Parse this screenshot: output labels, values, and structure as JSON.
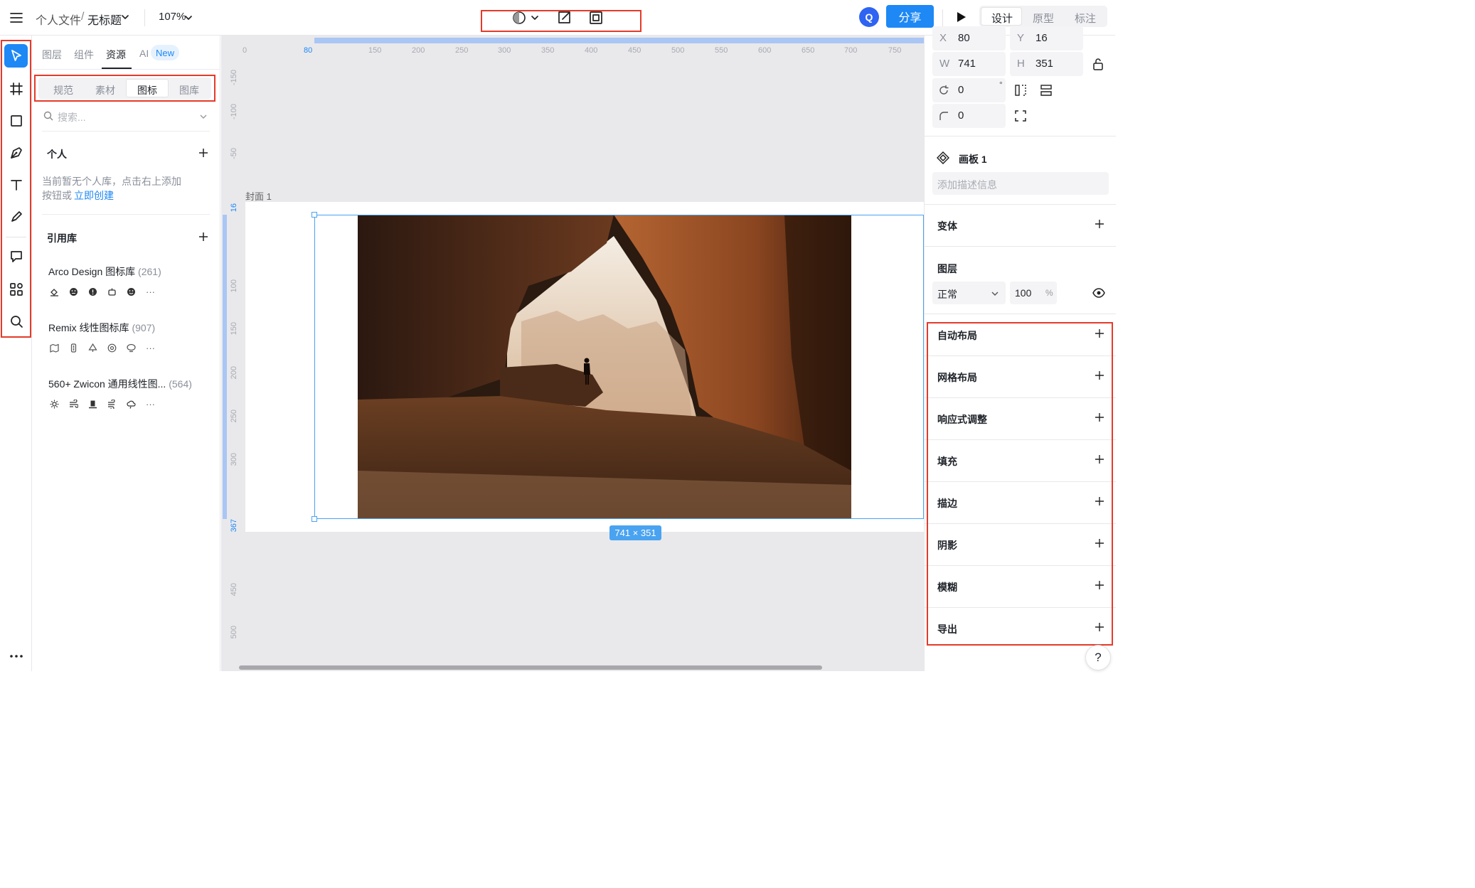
{
  "header": {
    "breadcrumb_parent": "个人文件",
    "breadcrumb_sep": "/",
    "file_name": "无标题",
    "zoom": "107%",
    "avatar_letter": "Q",
    "share_label": "分享",
    "mode_tabs": [
      "设计",
      "原型",
      "标注"
    ]
  },
  "left_panel": {
    "tabs": [
      "图层",
      "组件",
      "资源",
      "AI"
    ],
    "ai_badge": "New",
    "subtabs": [
      "规范",
      "素材",
      "图标",
      "图库"
    ],
    "search_placeholder": "搜索...",
    "personal_title": "个人",
    "personal_empty_line1": "当前暂无个人库，点击右上添加",
    "personal_empty_line2": "按钮或",
    "personal_create_link": "立即创建",
    "ref_title": "引用库",
    "libraries": [
      {
        "name": "Arco Design 图标库",
        "count": "(261)"
      },
      {
        "name": "Remix 线性图标库",
        "count": "(907)"
      },
      {
        "name": "560+ Zwicon 通用线性图...",
        "count": "(564)"
      }
    ],
    "more_glyph": "···"
  },
  "canvas": {
    "frame_name": "封面 1",
    "ruler_top": [
      "0",
      "80",
      "150",
      "200",
      "250",
      "300",
      "350",
      "400",
      "450",
      "500",
      "550",
      "600",
      "650",
      "700",
      "750"
    ],
    "ruler_left": [
      "-150",
      "-100",
      "-50",
      "16",
      "50",
      "100",
      "150",
      "200",
      "250",
      "300",
      "367",
      "450",
      "500"
    ],
    "size_label": "741 × 351",
    "image_alt": "desert rock arch with hiker silhouette"
  },
  "right_panel": {
    "x_label": "X",
    "x_value": "80",
    "y_label": "Y",
    "y_value": "16",
    "w_label": "W",
    "w_value": "741",
    "h_label": "H",
    "h_value": "351",
    "rotation_value": "0",
    "rotation_unit": "°",
    "radius_value": "0",
    "artboard_title": "画板 1",
    "description_placeholder": "添加描述信息",
    "transform_title": "变体",
    "layer_title": "图层",
    "blend_mode": "正常",
    "opacity_value": "100",
    "opacity_unit": "%",
    "sections": [
      "自动布局",
      "网格布局",
      "响应式调整",
      "填充",
      "描边",
      "阴影",
      "模糊",
      "导出"
    ],
    "help_glyph": "?"
  },
  "colors": {
    "accent": "#1e88f5",
    "annotation_red": "#e53a2a",
    "selection_blue": "#4aa3f0",
    "canvas_bg": "#e9e9ec"
  }
}
